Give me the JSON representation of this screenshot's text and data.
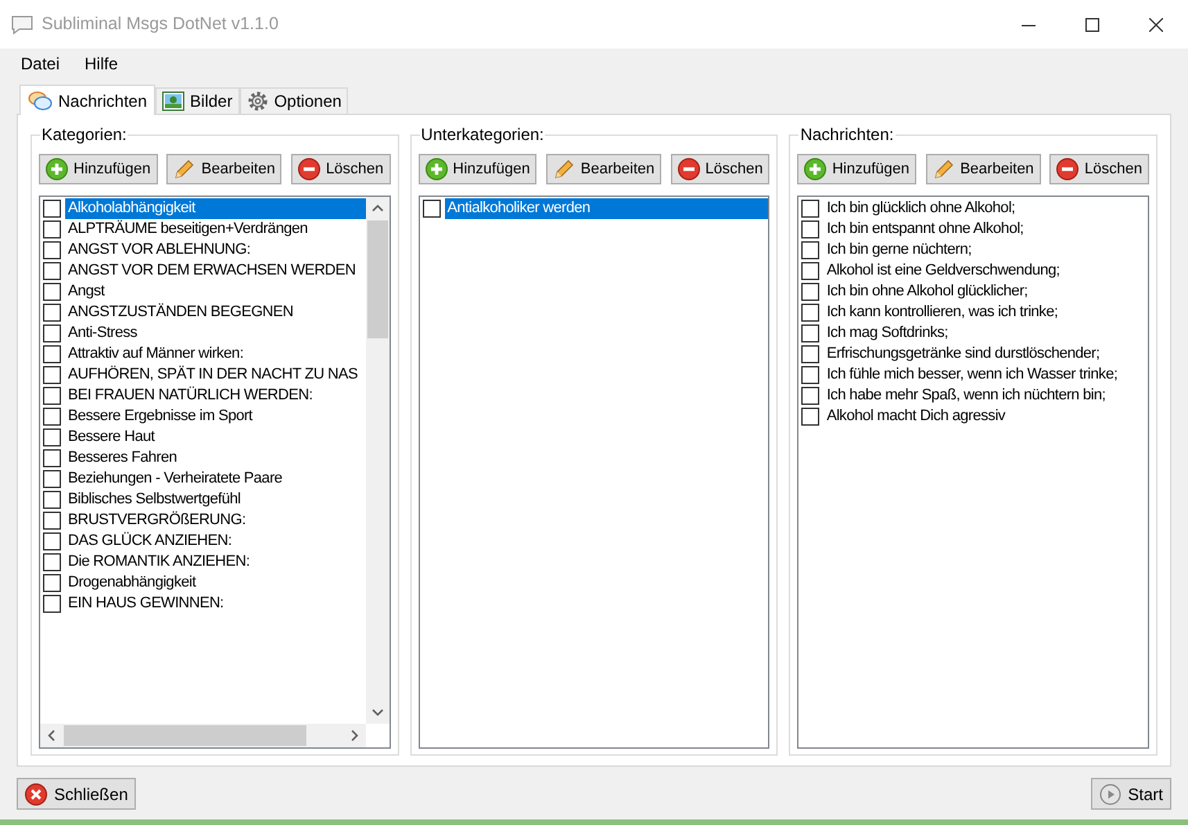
{
  "window": {
    "title": "Subliminal Msgs DotNet v1.1.0"
  },
  "menu": [
    "Datei",
    "Hilfe"
  ],
  "tabs": [
    {
      "label": "Nachrichten",
      "kind": "messages",
      "selected": true
    },
    {
      "label": "Bilder",
      "kind": "pictures",
      "selected": false
    },
    {
      "label": "Optionen",
      "kind": "options",
      "selected": false
    }
  ],
  "panels": [
    {
      "title": "Kategorien:",
      "buttons": [
        {
          "label": "Hinzufügen",
          "kind": "add"
        },
        {
          "label": "Bearbeiten",
          "kind": "edit"
        },
        {
          "label": "Löschen",
          "kind": "delete"
        }
      ],
      "scrollbars": true,
      "items": [
        {
          "text": "Alkoholabhängigkeit",
          "checked": false,
          "selected": true
        },
        {
          "text": "ALPTRÄUME beseitigen+Verdrängen",
          "checked": false,
          "selected": false
        },
        {
          "text": "ANGST VOR ABLEHNUNG:",
          "checked": false,
          "selected": false
        },
        {
          "text": "ANGST VOR DEM ERWACHSEN WERDEN",
          "checked": false,
          "selected": false
        },
        {
          "text": "Angst",
          "checked": false,
          "selected": false
        },
        {
          "text": "ANGSTZUSTÄNDEN BEGEGNEN",
          "checked": false,
          "selected": false
        },
        {
          "text": "Anti-Stress",
          "checked": false,
          "selected": false
        },
        {
          "text": "Attraktiv auf Männer wirken:",
          "checked": false,
          "selected": false
        },
        {
          "text": "AUFHÖREN, SPÄT IN DER NACHT ZU NAS",
          "checked": false,
          "selected": false
        },
        {
          "text": "BEI FRAUEN NATÜRLICH WERDEN:",
          "checked": false,
          "selected": false
        },
        {
          "text": "Bessere Ergebnisse im Sport",
          "checked": false,
          "selected": false
        },
        {
          "text": "Bessere Haut",
          "checked": false,
          "selected": false
        },
        {
          "text": "Besseres Fahren",
          "checked": false,
          "selected": false
        },
        {
          "text": "Beziehungen - Verheiratete Paare",
          "checked": false,
          "selected": false
        },
        {
          "text": "Biblisches Selbstwertgefühl",
          "checked": false,
          "selected": false
        },
        {
          "text": "BRUSTVERGRÖßERUNG:",
          "checked": false,
          "selected": false
        },
        {
          "text": "DAS GLÜCK ANZIEHEN:",
          "checked": false,
          "selected": false
        },
        {
          "text": "Die ROMANTIK ANZIEHEN:",
          "checked": false,
          "selected": false
        },
        {
          "text": "Drogenabhängigkeit",
          "checked": false,
          "selected": false
        },
        {
          "text": "EIN HAUS GEWINNEN:",
          "checked": false,
          "selected": false
        }
      ]
    },
    {
      "title": "Unterkategorien:",
      "buttons": [
        {
          "label": "Hinzufügen",
          "kind": "add"
        },
        {
          "label": "Bearbeiten",
          "kind": "edit"
        },
        {
          "label": "Löschen",
          "kind": "delete"
        }
      ],
      "scrollbars": false,
      "items": [
        {
          "text": "Antialkoholiker werden",
          "checked": false,
          "selected": true
        }
      ]
    },
    {
      "title": "Nachrichten:",
      "buttons": [
        {
          "label": "Hinzufügen",
          "kind": "add"
        },
        {
          "label": "Bearbeiten",
          "kind": "edit"
        },
        {
          "label": "Löschen",
          "kind": "delete"
        }
      ],
      "scrollbars": false,
      "items": [
        {
          "text": "Ich bin glücklich ohne Alkohol;",
          "checked": false,
          "selected": false
        },
        {
          "text": "Ich bin entspannt ohne Alkohol;",
          "checked": false,
          "selected": false
        },
        {
          "text": "Ich bin gerne nüchtern;",
          "checked": false,
          "selected": false
        },
        {
          "text": "Alkohol ist eine Geldverschwendung;",
          "checked": false,
          "selected": false
        },
        {
          "text": "Ich bin ohne Alkohol glücklicher;",
          "checked": false,
          "selected": false
        },
        {
          "text": "Ich kann kontrollieren, was ich trinke;",
          "checked": false,
          "selected": false
        },
        {
          "text": "Ich mag Softdrinks;",
          "checked": false,
          "selected": false
        },
        {
          "text": "Erfrischungsgetränke sind durstlöschender;",
          "checked": false,
          "selected": false
        },
        {
          "text": "Ich fühle mich besser, wenn ich Wasser trinke;",
          "checked": false,
          "selected": false
        },
        {
          "text": "Ich habe mehr Spaß, wenn ich nüchtern bin;",
          "checked": false,
          "selected": false
        },
        {
          "text": "Alkohol macht Dich agressiv",
          "checked": false,
          "selected": false
        }
      ]
    }
  ],
  "footer": [
    {
      "label": "Schließen",
      "kind": "close"
    },
    {
      "label": "Start",
      "kind": "start"
    }
  ]
}
